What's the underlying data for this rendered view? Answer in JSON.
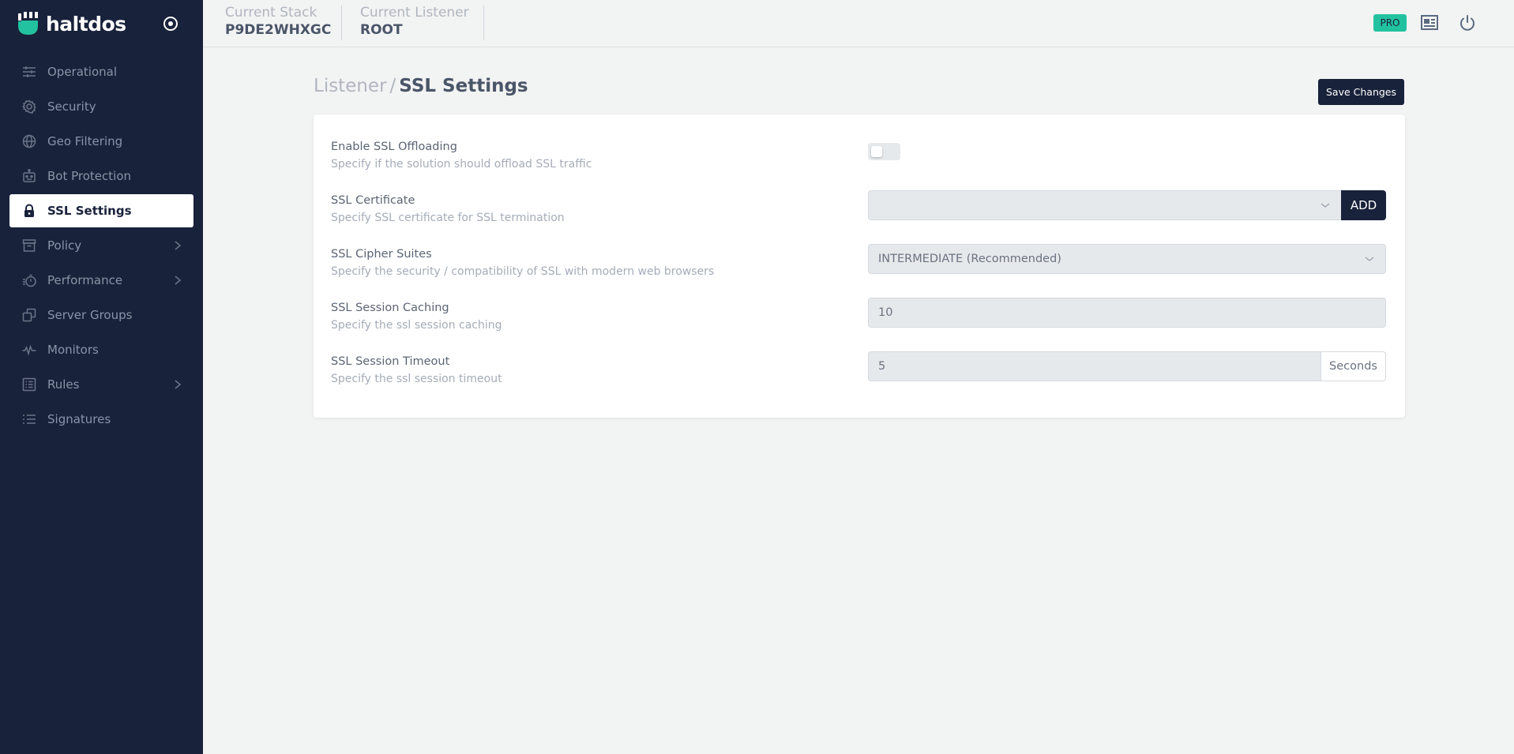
{
  "app": {
    "name": "haltdos"
  },
  "sidebar": {
    "items": [
      {
        "label": "Operational",
        "icon": "sliders-icon",
        "active": false,
        "has_children": false
      },
      {
        "label": "Security",
        "icon": "gear-icon",
        "active": false,
        "has_children": false
      },
      {
        "label": "Geo Filtering",
        "icon": "globe-icon",
        "active": false,
        "has_children": false
      },
      {
        "label": "Bot Protection",
        "icon": "robot-icon",
        "active": false,
        "has_children": false
      },
      {
        "label": "SSL Settings",
        "icon": "lock-icon",
        "active": true,
        "has_children": false
      },
      {
        "label": "Policy",
        "icon": "archive-icon",
        "active": false,
        "has_children": true
      },
      {
        "label": "Performance",
        "icon": "stopwatch-icon",
        "active": false,
        "has_children": true
      },
      {
        "label": "Server Groups",
        "icon": "copy-icon",
        "active": false,
        "has_children": false
      },
      {
        "label": "Monitors",
        "icon": "pulse-icon",
        "active": false,
        "has_children": false
      },
      {
        "label": "Rules",
        "icon": "list-box-icon",
        "active": false,
        "has_children": true
      },
      {
        "label": "Signatures",
        "icon": "list-icon",
        "active": false,
        "has_children": false
      }
    ]
  },
  "topbar": {
    "stack_label": "Current Stack",
    "stack_value": "P9DE2WHXGC",
    "listener_label": "Current Listener",
    "listener_value": "ROOT",
    "badge": "PRO",
    "badge_color": "#22c2a0"
  },
  "page": {
    "breadcrumb_parent": "Listener",
    "breadcrumb_separator": "/",
    "title": "SSL Settings",
    "save_label": "Save Changes"
  },
  "settings": {
    "ssl_offloading": {
      "label": "Enable SSL Offloading",
      "desc": "Specify if the solution should offload SSL traffic",
      "enabled": false
    },
    "ssl_certificate": {
      "label": "SSL Certificate",
      "desc": "Specify SSL certificate for SSL termination",
      "value": "",
      "add_label": "ADD"
    },
    "ssl_cipher_suites": {
      "label": "SSL Cipher Suites",
      "desc": "Specify the security / compatibility of SSL with modern web browsers",
      "value": "INTERMEDIATE (Recommended)"
    },
    "ssl_session_caching": {
      "label": "SSL Session Caching",
      "desc": "Specify the ssl session caching",
      "value": "10"
    },
    "ssl_session_timeout": {
      "label": "SSL Session Timeout",
      "desc": "Specify the ssl session timeout",
      "value": "5",
      "unit": "Seconds"
    }
  },
  "colors": {
    "sidebar_bg": "#19223b",
    "accent": "#22c2a0",
    "page_bg": "#f2f3f3"
  }
}
